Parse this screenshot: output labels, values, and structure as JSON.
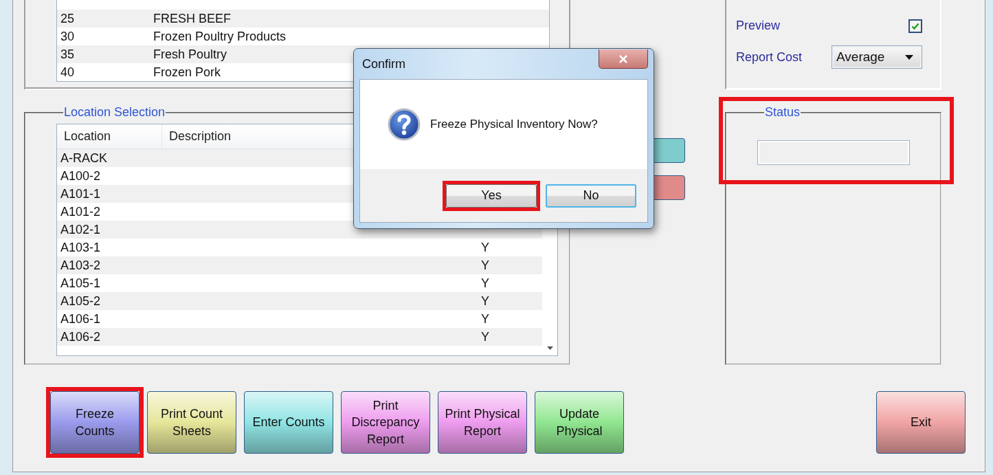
{
  "top_list": {
    "rows": [
      {
        "code": "25",
        "description": "FRESH BEEF"
      },
      {
        "code": "30",
        "description": "Frozen Poultry Products"
      },
      {
        "code": "35",
        "description": "Fresh Poultry"
      },
      {
        "code": "40",
        "description": "Frozen Pork"
      }
    ]
  },
  "location_selection": {
    "title": "Location Selection",
    "columns": [
      "Location",
      "Description"
    ],
    "rows": [
      {
        "location": "A-RACK"
      },
      {
        "location": "A100-2"
      },
      {
        "location": "A101-1"
      },
      {
        "location": "A101-2"
      },
      {
        "location": "A102-1"
      },
      {
        "location": "A103-1",
        "column_3": "Y"
      },
      {
        "location": "A103-2",
        "column_3": "Y"
      },
      {
        "location": "A105-1",
        "column_3": "Y"
      },
      {
        "location": "A105-2",
        "column_3": "Y"
      },
      {
        "location": "A106-1",
        "column_3": "Y"
      },
      {
        "location": "A106-2",
        "column_3": "Y"
      }
    ]
  },
  "side_buttons": [
    {
      "color": "#7fcccc"
    },
    {
      "color": "#e08a8a"
    }
  ],
  "options": {
    "preview": {
      "label": "Preview",
      "checked": true
    },
    "report_cost": {
      "label": "Report Cost",
      "value": "Average"
    }
  },
  "status": {
    "title": "Status",
    "highlighted": true
  },
  "buttons": [
    {
      "label": "Freeze\nCounts",
      "color": "#9a9aec",
      "highlighted": true
    },
    {
      "label": "Print Count\nSheets",
      "color": "#e6e69a",
      "highlighted": false
    },
    {
      "label": "Enter Counts",
      "color": "#90e4e4",
      "highlighted": false
    },
    {
      "label": "Print\nDiscrepancy\nReport",
      "color": "#ee9cee",
      "highlighted": false
    },
    {
      "label": "Print Physical\nReport",
      "color": "#ee9cee",
      "highlighted": false
    },
    {
      "label": "Update\nPhysical",
      "color": "#90e690",
      "highlighted": false
    }
  ],
  "exit_button": {
    "label": "Exit",
    "color": "#f0a4a4"
  },
  "dialog": {
    "title": "Confirm",
    "message": "Freeze Physical Inventory Now?",
    "buttons": [
      {
        "label": "Yes",
        "highlighted": true,
        "focused": false
      },
      {
        "label": "No",
        "highlighted": false,
        "focused": true
      }
    ]
  }
}
